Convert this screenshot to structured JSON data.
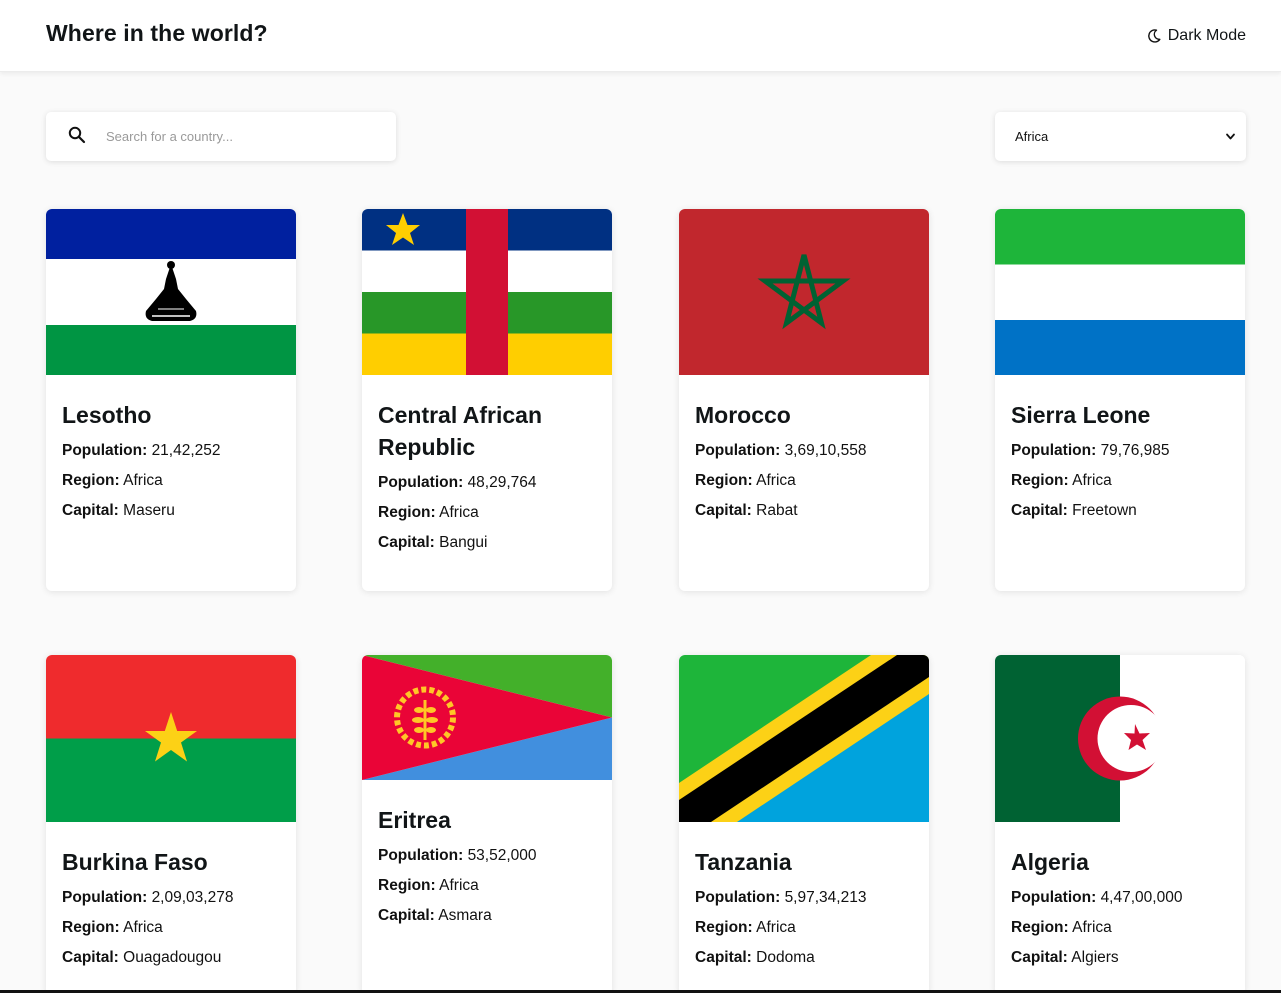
{
  "header": {
    "title": "Where in the world?",
    "theme_toggle_label": "Dark Mode",
    "theme_icon": "moon-icon"
  },
  "search": {
    "placeholder": "Search for a country...",
    "value": "",
    "icon": "search-icon"
  },
  "region_filter": {
    "selected": "Africa",
    "icon": "chevron-down-icon"
  },
  "labels": {
    "population": "Population:",
    "region": "Region:",
    "capital": "Capital:"
  },
  "countries": [
    {
      "name": "Lesotho",
      "population": "21,42,252",
      "region": "Africa",
      "capital": "Maseru",
      "flag": "lesotho-flag"
    },
    {
      "name": "Central African Republic",
      "population": "48,29,764",
      "region": "Africa",
      "capital": "Bangui",
      "flag": "central-african-republic-flag"
    },
    {
      "name": "Morocco",
      "population": "3,69,10,558",
      "region": "Africa",
      "capital": "Rabat",
      "flag": "morocco-flag"
    },
    {
      "name": "Sierra Leone",
      "population": "79,76,985",
      "region": "Africa",
      "capital": "Freetown",
      "flag": "sierra-leone-flag"
    },
    {
      "name": "Burkina Faso",
      "population": "2,09,03,278",
      "region": "Africa",
      "capital": "Ouagadougou",
      "flag": "burkina-faso-flag"
    },
    {
      "name": "Eritrea",
      "population": "53,52,000",
      "region": "Africa",
      "capital": "Asmara",
      "flag": "eritrea-flag"
    },
    {
      "name": "Tanzania",
      "population": "5,97,34,213",
      "region": "Africa",
      "capital": "Dodoma",
      "flag": "tanzania-flag"
    },
    {
      "name": "Algeria",
      "population": "4,47,00,000",
      "region": "Africa",
      "capital": "Algiers",
      "flag": "algeria-flag"
    }
  ],
  "colors": {
    "background": "#fafafa",
    "surface": "#ffffff",
    "text": "#111517"
  }
}
